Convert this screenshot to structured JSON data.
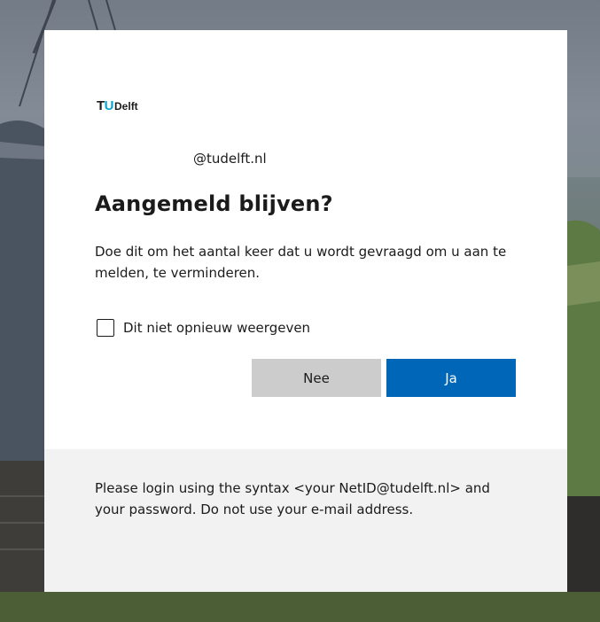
{
  "brand": {
    "logo_tu": "TU",
    "logo_t": "T",
    "logo_u": "U",
    "logo_delft": "Delft",
    "accent_color": "#00a6d6"
  },
  "identity": {
    "account": "@tudelft.nl"
  },
  "prompt": {
    "title": "Aangemeld blijven?",
    "description": "Doe dit om het aantal keer dat u wordt gevraagd om u aan te melden, te verminderen.",
    "checkbox_label": "Dit niet opnieuw weergeven",
    "checkbox_checked": false
  },
  "actions": {
    "no_label": "Nee",
    "yes_label": "Ja",
    "primary_color": "#0067b8"
  },
  "footer": {
    "text": "Please login using the syntax <your NetID@tudelft.nl> and your password. Do not use your e-mail address."
  }
}
